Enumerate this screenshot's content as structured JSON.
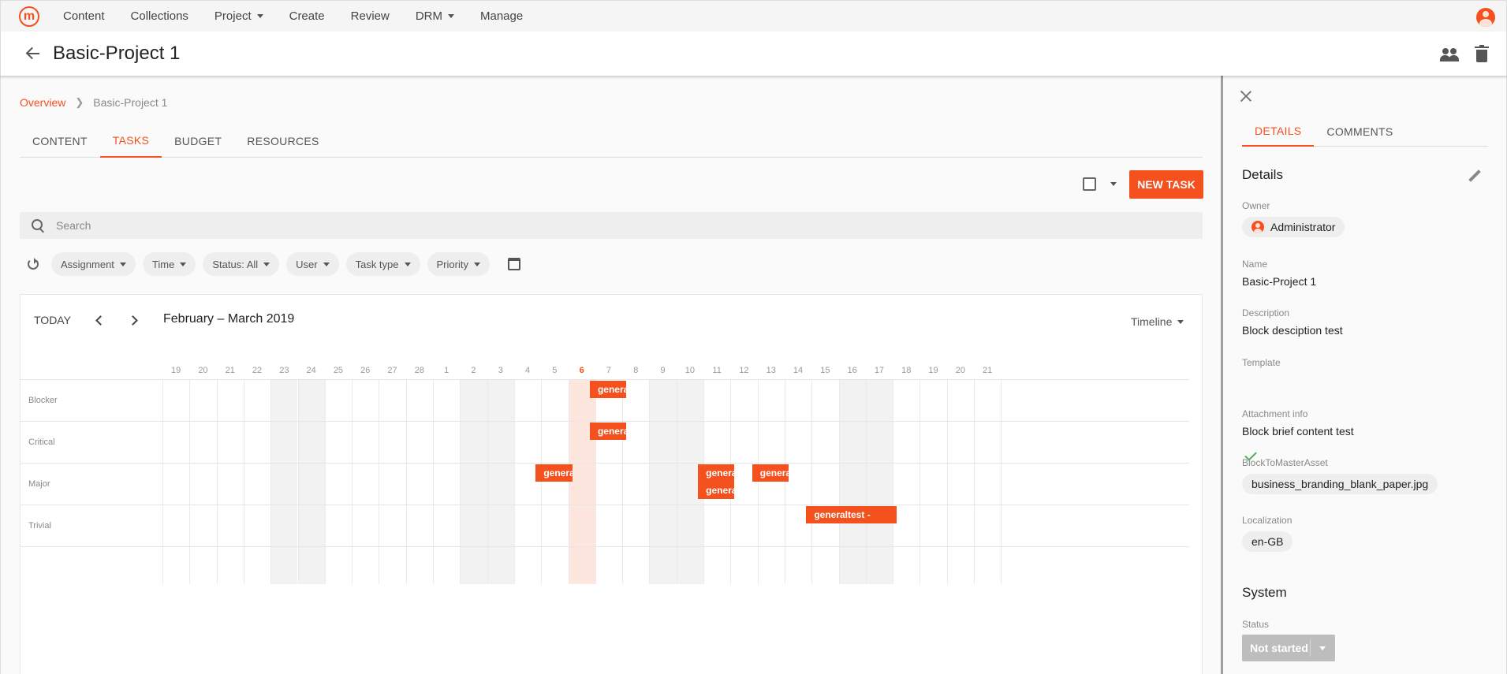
{
  "nav": {
    "logo": "m",
    "items": [
      "Content",
      "Collections",
      "Project",
      "Create",
      "Review",
      "DRM",
      "Manage"
    ]
  },
  "header": {
    "title": "Basic-Project 1"
  },
  "breadcrumb": {
    "root": "Overview",
    "current": "Basic-Project 1"
  },
  "tabs": [
    "CONTENT",
    "TASKS",
    "BUDGET",
    "RESOURCES"
  ],
  "toolbar": {
    "new_task": "NEW TASK"
  },
  "search": {
    "placeholder": "Search"
  },
  "filters": [
    "Assignment",
    "Time",
    "Status: All",
    "User",
    "Task type",
    "Priority"
  ],
  "calendar": {
    "today_label": "TODAY",
    "range": "February – March 2019",
    "view": "Timeline",
    "days": [
      "19",
      "20",
      "21",
      "22",
      "23",
      "24",
      "25",
      "26",
      "27",
      "28",
      "1",
      "2",
      "3",
      "4",
      "5",
      "6",
      "7",
      "8",
      "9",
      "10",
      "11",
      "12",
      "13",
      "14",
      "15",
      "16",
      "17",
      "18",
      "19",
      "20",
      "21"
    ],
    "today_index": 15,
    "weekend_indices": [
      4,
      5,
      11,
      12,
      18,
      19,
      25,
      26
    ],
    "rows": [
      "Blocker",
      "Critical",
      "Major",
      "Trivial"
    ],
    "tasks": [
      {
        "label": "generaltest -",
        "row": 0,
        "start": 16,
        "span": 1.35,
        "lane": 0
      },
      {
        "label": "generaltest -",
        "row": 1,
        "start": 16,
        "span": 1.35,
        "lane": 0
      },
      {
        "label": "generaltest -",
        "row": 2,
        "start": 14,
        "span": 1.35,
        "lane": 0
      },
      {
        "label": "generaltest -",
        "row": 2,
        "start": 20,
        "span": 1.35,
        "lane": 0
      },
      {
        "label": "generaltest -",
        "row": 2,
        "start": 20,
        "span": 1.35,
        "lane": 1
      },
      {
        "label": "generaltest -",
        "row": 2,
        "start": 22,
        "span": 1.35,
        "lane": 0
      },
      {
        "label": "generaltest -",
        "row": 3,
        "start": 24,
        "span": 3.35,
        "lane": 0
      }
    ]
  },
  "panel": {
    "tabs": [
      "DETAILS",
      "COMMENTS"
    ],
    "details_title": "Details",
    "owner_label": "Owner",
    "owner": "Administrator",
    "name_label": "Name",
    "name": "Basic-Project 1",
    "description_label": "Description",
    "description": "Block desciption test",
    "template_label": "Template",
    "attachment_label": "Attachment info",
    "attachment": "Block brief content test",
    "master_asset_label": "BlockToMasterAsset",
    "master_asset": "business_branding_blank_paper.jpg",
    "localization_label": "Localization",
    "localization": "en-GB",
    "system_title": "System",
    "status_label": "Status",
    "status": "Not started"
  },
  "colors": {
    "accent": "#f4511e",
    "today_bg": "#fde6de",
    "weekend_bg": "#f2f2f2"
  }
}
